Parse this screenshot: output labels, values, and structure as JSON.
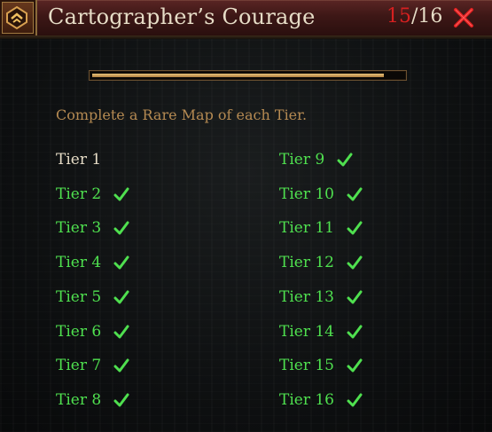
{
  "header": {
    "title": "Cartographer’s Courage",
    "completed": "15",
    "separator": "/",
    "total": "16"
  },
  "progress": {
    "fraction": 0.9375
  },
  "description": "Complete a Rare Map of each Tier.",
  "colors": {
    "complete": "#4fe04f",
    "incomplete": "#e6dcc6",
    "count_done": "#d62020",
    "description": "#b58a52"
  },
  "tiers_left": [
    {
      "label": "Tier 1",
      "complete": false
    },
    {
      "label": "Tier 2",
      "complete": true
    },
    {
      "label": "Tier 3",
      "complete": true
    },
    {
      "label": "Tier 4",
      "complete": true
    },
    {
      "label": "Tier 5",
      "complete": true
    },
    {
      "label": "Tier 6",
      "complete": true
    },
    {
      "label": "Tier 7",
      "complete": true
    },
    {
      "label": "Tier 8",
      "complete": true
    }
  ],
  "tiers_right": [
    {
      "label": "Tier 9",
      "complete": true
    },
    {
      "label": "Tier 10",
      "complete": true
    },
    {
      "label": "Tier 11",
      "complete": true
    },
    {
      "label": "Tier 12",
      "complete": true
    },
    {
      "label": "Tier 13",
      "complete": true
    },
    {
      "label": "Tier 14",
      "complete": true
    },
    {
      "label": "Tier 15",
      "complete": true
    },
    {
      "label": "Tier 16",
      "complete": true
    }
  ],
  "icons": {
    "emblem": "achievement-emblem-icon",
    "close": "close-icon",
    "check": "checkmark-icon"
  }
}
